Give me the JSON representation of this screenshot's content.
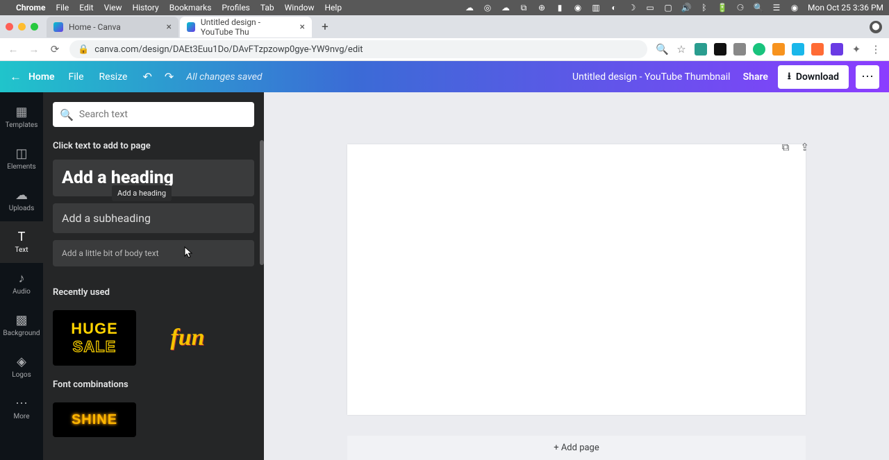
{
  "menubar": {
    "app": "Chrome",
    "menus": [
      "File",
      "Edit",
      "View",
      "History",
      "Bookmarks",
      "Profiles",
      "Tab",
      "Window",
      "Help"
    ],
    "clock": "Mon Oct 25  3:36 PM"
  },
  "tabs": {
    "t1": {
      "title": "Home - Canva"
    },
    "t2": {
      "title": "Untitled design - YouTube Thu"
    }
  },
  "urlbar": {
    "url": "canva.com/design/DAEt3Euu1Do/DAvFTzpzowp0gye-YW9nvg/edit"
  },
  "appbar": {
    "home": "Home",
    "file": "File",
    "resize": "Resize",
    "status": "All changes saved",
    "docTitle": "Untitled design - YouTube Thumbnail",
    "share": "Share",
    "download": "Download"
  },
  "rail": {
    "templates": "Templates",
    "elements": "Elements",
    "uploads": "Uploads",
    "text": "Text",
    "audio": "Audio",
    "background": "Background",
    "logos": "Logos",
    "more": "More"
  },
  "panel": {
    "searchPlaceholder": "Search text",
    "clickPrompt": "Click text to add to page",
    "heading": "Add a heading",
    "subheading": "Add a subheading",
    "body": "Add a little bit of body text",
    "tooltip": "Add a heading",
    "recently": "Recently used",
    "hugeLine1": "HUGE",
    "hugeLine2": "SALE",
    "fun": "fun",
    "fontCombos": "Font combinations",
    "shine": "SHINE"
  },
  "canvas": {
    "addPage": "+ Add page"
  }
}
